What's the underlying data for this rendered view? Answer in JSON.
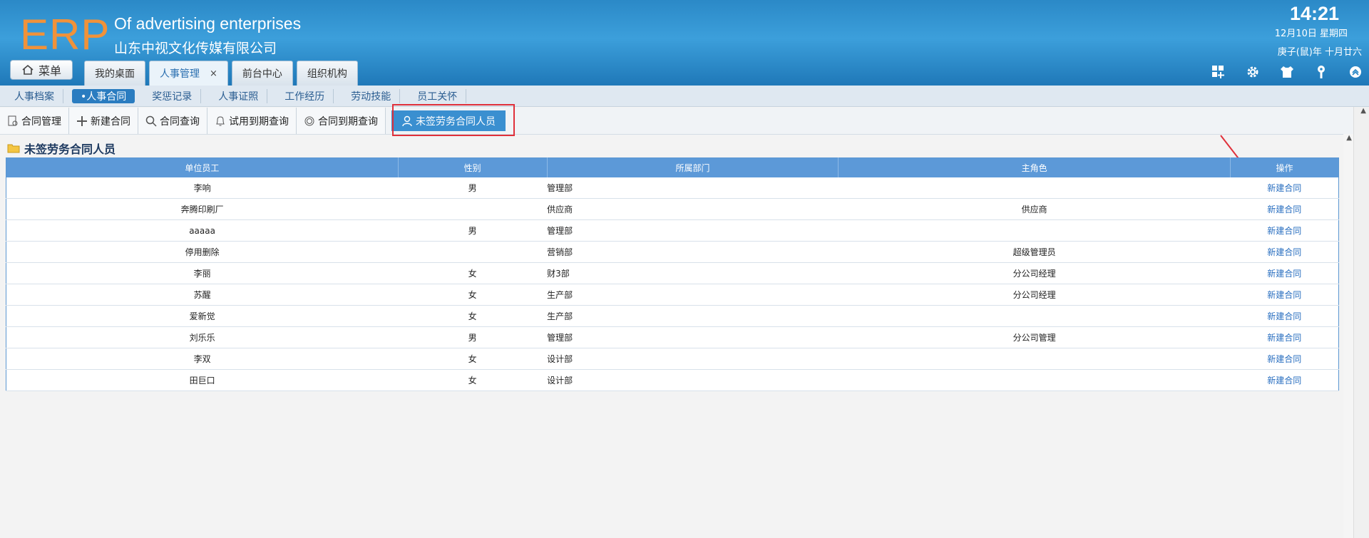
{
  "header": {
    "logo": "ERP",
    "company_en": "Of advertising enterprises",
    "company_cn": "山东中视文化传媒有限公司",
    "time": "14:21",
    "date": "12月10日 星期四",
    "lunar": "庚子(鼠)年 十月廿六",
    "menu_label": "菜单",
    "tabs": [
      {
        "label": "我的桌面"
      },
      {
        "label": "人事管理",
        "close": "×"
      },
      {
        "label": "前台中心"
      },
      {
        "label": "组织机构"
      }
    ]
  },
  "subnav": [
    "人事档案",
    "•人事合同",
    "奖惩记录",
    "人事证照",
    "工作经历",
    "劳动技能",
    "员工关怀"
  ],
  "toolbar": [
    "合同管理",
    "新建合同",
    "合同查询",
    "试用到期查询",
    "合同到期查询",
    "未签劳务合同人员"
  ],
  "section_title": "未签劳务合同人员",
  "table": {
    "headers": [
      "单位员工",
      "性别",
      "所属部门",
      "主角色",
      "操作"
    ],
    "rows": [
      [
        "李响",
        "男",
        "管理部",
        "",
        "新建合同"
      ],
      [
        "奔腾印刷厂",
        "",
        "供应商",
        "供应商",
        "新建合同"
      ],
      [
        "aaaaa",
        "男",
        "管理部",
        "",
        "新建合同"
      ],
      [
        "停用删除",
        "",
        "营销部",
        "超级管理员",
        "新建合同"
      ],
      [
        "李丽",
        "女",
        "财3部",
        "分公司经理",
        "新建合同"
      ],
      [
        "苏醒",
        "女",
        "生产部",
        "分公司经理",
        "新建合同"
      ],
      [
        "爱新觉",
        "女",
        "生产部",
        "",
        "新建合同"
      ],
      [
        "刘乐乐",
        "男",
        "管理部",
        "分公司管理",
        "新建合同"
      ],
      [
        "李双",
        "女",
        "设计部",
        "",
        "新建合同"
      ],
      [
        "田巨口",
        "女",
        "设计部",
        "",
        "新建合同"
      ]
    ]
  },
  "colors": {
    "header": "#2b89c7",
    "logo": "#f0923a",
    "highlight": "#e0303a",
    "grid_header": "#5c99d8"
  }
}
